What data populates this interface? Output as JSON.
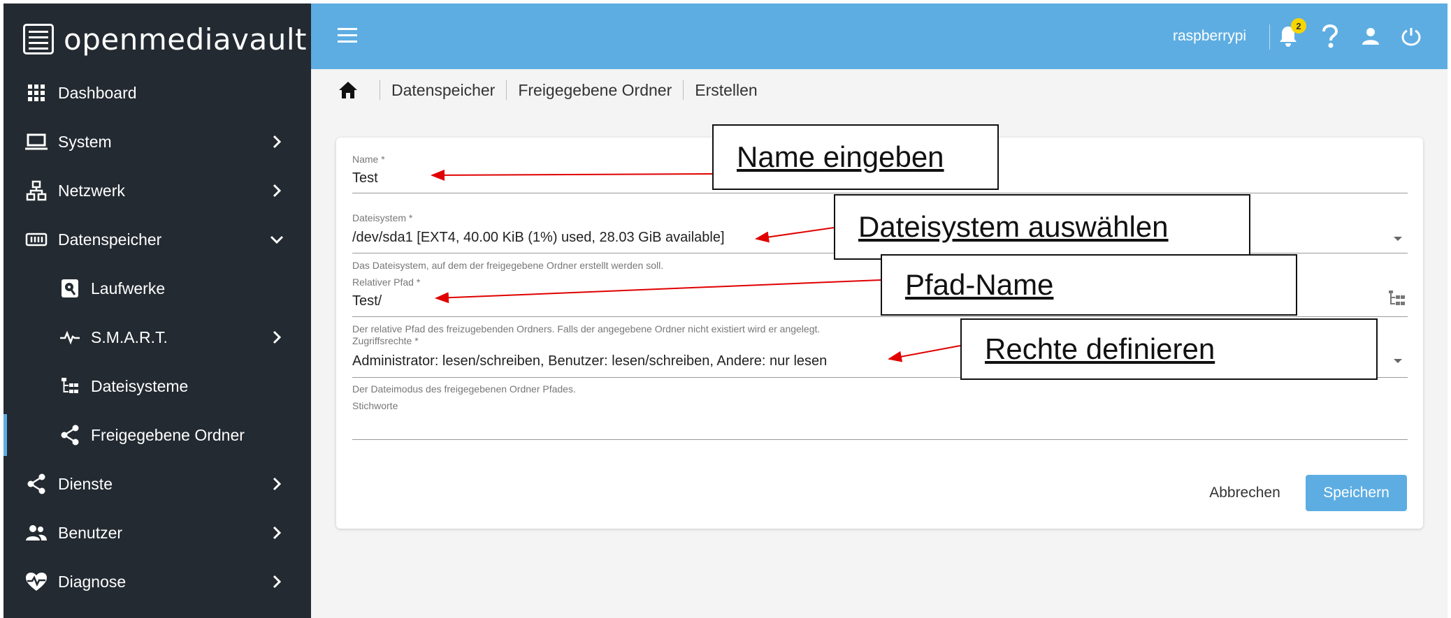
{
  "app": {
    "name": "openmediavault",
    "hostname": "raspberrypi",
    "notification_count": "2"
  },
  "sidebar": {
    "items": [
      {
        "label": "Dashboard",
        "icon": "grid-icon"
      },
      {
        "label": "System",
        "icon": "laptop-icon"
      },
      {
        "label": "Netzwerk",
        "icon": "network-icon"
      },
      {
        "label": "Datenspeicher",
        "icon": "storage-icon"
      },
      {
        "label": "Laufwerke",
        "icon": "disk-icon"
      },
      {
        "label": "S.M.A.R.T.",
        "icon": "pulse-icon"
      },
      {
        "label": "Dateisysteme",
        "icon": "tree-icon"
      },
      {
        "label": "Freigegebene Ordner",
        "icon": "share-icon"
      },
      {
        "label": "Dienste",
        "icon": "share-icon"
      },
      {
        "label": "Benutzer",
        "icon": "users-icon"
      },
      {
        "label": "Diagnose",
        "icon": "heartbeat-icon"
      }
    ]
  },
  "breadcrumb": [
    "Datenspeicher",
    "Freigegebene Ordner",
    "Erstellen"
  ],
  "form": {
    "name": {
      "label": "Name *",
      "value": "Test"
    },
    "filesystem": {
      "label": "Dateisystem *",
      "value": "/dev/sda1 [EXT4, 40.00 KiB (1%) used, 28.03 GiB available]",
      "hint": "Das Dateisystem, auf dem der freigegebene Ordner erstellt werden soll."
    },
    "path": {
      "label": "Relativer Pfad *",
      "value": "Test/",
      "hint": "Der relative Pfad des freizugebenden Ordners. Falls der angegebene Ordner nicht existiert wird er angelegt."
    },
    "permissions": {
      "label": "Zugriffsrechte *",
      "value": "Administrator: lesen/schreiben, Benutzer: lesen/schreiben, Andere: nur lesen",
      "hint": "Der Dateimodus des freigegebenen Ordner Pfades."
    },
    "tags": {
      "label": "Stichworte",
      "value": ""
    },
    "cancel_label": "Abbrechen",
    "save_label": "Speichern"
  },
  "annotations": [
    "Name eingeben",
    "Dateisystem auswählen",
    "Pfad-Name",
    "Rechte definieren"
  ],
  "colors": {
    "sidebar": "#232a31",
    "topbar": "#5dade2",
    "accent": "#5dade2",
    "badge": "#f7d500",
    "arrow": "#e00000"
  }
}
